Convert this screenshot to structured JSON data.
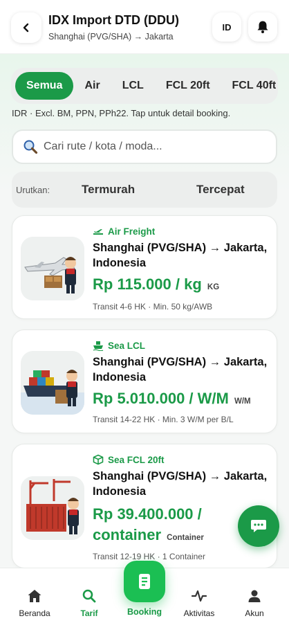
{
  "header": {
    "title": "IDX Import DTD (DDU)",
    "subtitle": "Shanghai (PVG/SHA) → Jakarta",
    "lang_label": "ID",
    "back_icon": "chevron-left-icon",
    "bell_icon": "bell-icon"
  },
  "tabs": [
    {
      "label": "Semua",
      "active": true
    },
    {
      "label": "Air",
      "active": false
    },
    {
      "label": "LCL",
      "active": false
    },
    {
      "label": "FCL 20ft",
      "active": false
    },
    {
      "label": "FCL 40ft",
      "active": false
    }
  ],
  "info_text": "IDR · Excl. BM, PPN, PPh22. Tap untuk detail booking.",
  "search": {
    "placeholder": "Cari rute / kota / moda..."
  },
  "sort": {
    "label": "Urutkan:",
    "options": [
      "Termurah",
      "Tercepat"
    ]
  },
  "cards": [
    {
      "mode": "Air Freight",
      "mode_icon": "plane-icon",
      "route": "Shanghai (PVG/SHA) → Jakarta, Indonesia",
      "price": "Rp 115.000 / kg",
      "unit": "KG",
      "note": "Transit 4-6 HK · Min. 50 kg/AWB"
    },
    {
      "mode": "Sea LCL",
      "mode_icon": "ship-icon",
      "route": "Shanghai (PVG/SHA) → Jakarta, Indonesia",
      "price": "Rp 5.010.000 / W/M",
      "unit": "W/M",
      "note": "Transit 14-22 HK · Min. 3 W/M per B/L"
    },
    {
      "mode": "Sea FCL 20ft",
      "mode_icon": "box-icon",
      "route": "Shanghai (PVG/SHA) → Jakarta, Indonesia",
      "price": "Rp 39.400.000 / container",
      "unit": "Container",
      "note": "Transit 12-19 HK · 1 Container"
    }
  ],
  "nav": {
    "items": [
      {
        "label": "Beranda",
        "icon": "home-icon",
        "active": false
      },
      {
        "label": "Tarif",
        "icon": "search-icon",
        "active": true
      },
      {
        "label": "Booking",
        "icon": "document-icon",
        "active": false
      },
      {
        "label": "Aktivitas",
        "icon": "activity-icon",
        "active": false
      },
      {
        "label": "Akun",
        "icon": "user-icon",
        "active": false
      }
    ]
  },
  "fab_icon": "chat-icon",
  "colors": {
    "accent": "#1b9a48",
    "accent_bright": "#1bbf53"
  }
}
